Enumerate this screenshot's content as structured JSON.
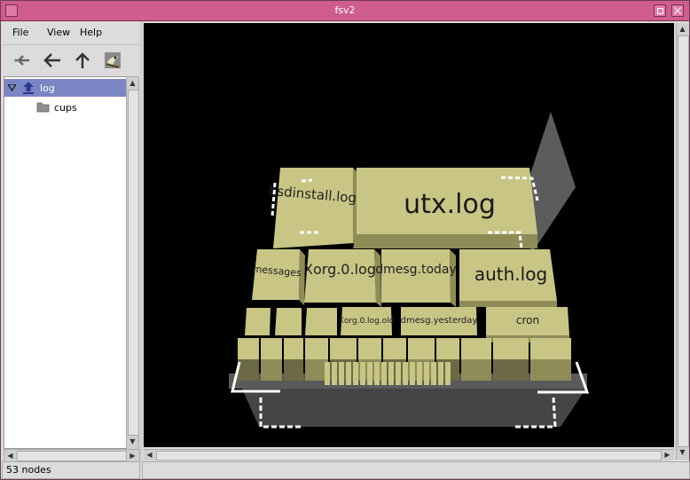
{
  "window": {
    "title": "fsv2"
  },
  "menu": {
    "file": "File",
    "view": "View",
    "help": "Help"
  },
  "toolbar": {
    "icons": [
      "back-history-icon",
      "back-icon",
      "up-icon",
      "bird-view-icon"
    ]
  },
  "tree": {
    "items": [
      {
        "label": "log",
        "selected": true,
        "expanded": true
      },
      {
        "label": "cups",
        "selected": false
      }
    ]
  },
  "status": {
    "nodes": "53 nodes"
  },
  "viz": {
    "nodes": {
      "utx": "utx.log",
      "bsdinstall": "bsdinstall.log",
      "messages": "messages",
      "xorg": "Xorg.0.log",
      "dmesg_today": "dmesg.today",
      "auth": "auth.log",
      "xorg_old": "Xorg.0.log.old",
      "dmesg_yesterday": "dmesg.yesterday",
      "cron": "cron"
    },
    "colors": {
      "box": "#c9c585",
      "box_side": "#8f8c58",
      "box_dark": "#6b6a45",
      "platform": "#4a4a4a",
      "highlight": "#ffffff"
    }
  }
}
